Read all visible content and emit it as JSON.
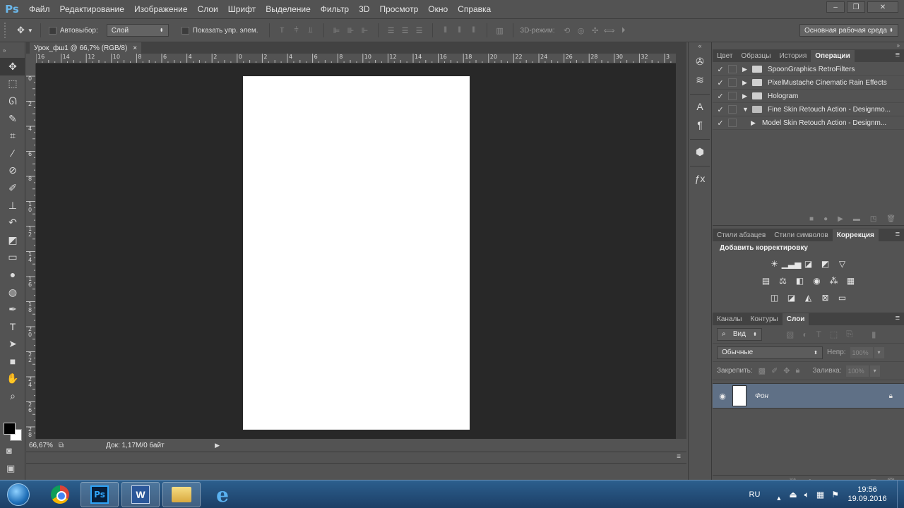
{
  "app": {
    "logo": "Ps"
  },
  "menu": [
    "Файл",
    "Редактирование",
    "Изображение",
    "Слои",
    "Шрифт",
    "Выделение",
    "Фильтр",
    "3D",
    "Просмотр",
    "Окно",
    "Справка"
  ],
  "window_controls": {
    "minimize": "–",
    "restore": "❐",
    "close": "✕"
  },
  "options": {
    "auto_select_label": "Автовыбор:",
    "auto_select_value": "Слой",
    "show_transform_label": "Показать упр. элем.",
    "mode_3d_label": "3D-режим:",
    "workspace": "Основная рабочая среда"
  },
  "document": {
    "tab_title": "Урок_фш1 @ 66,7% (RGB/8)",
    "tab_close": "×",
    "zoom": "66,67%",
    "doc_info": "Док: 1,17M/0 байт",
    "ruler_h": [
      "16",
      "14",
      "12",
      "10",
      "8",
      "6",
      "4",
      "2",
      "0",
      "2",
      "4",
      "6",
      "8",
      "10",
      "12",
      "14",
      "16",
      "18",
      "20",
      "22",
      "24",
      "26",
      "28",
      "30",
      "32",
      "3"
    ],
    "ruler_v": [
      "0",
      "2",
      "4",
      "6",
      "8",
      "1 0",
      "1 2",
      "1 4",
      "1 6",
      "1 8",
      "2 0",
      "2 2",
      "2 4",
      "2 6",
      "2 8"
    ]
  },
  "panels": {
    "actions": {
      "tabs": [
        "Цвет",
        "Образцы",
        "История",
        "Операции"
      ],
      "active_tab": "Операции",
      "items": [
        {
          "check": "✓",
          "expand": "▶",
          "name": "SpoonGraphics RetroFilters",
          "folder": true
        },
        {
          "check": "✓",
          "expand": "▶",
          "name": "PixelMustache Cinematic Rain Effects",
          "folder": true
        },
        {
          "check": "✓",
          "expand": "▶",
          "name": "Hologram",
          "folder": true
        },
        {
          "check": "✓",
          "expand": "▼",
          "name": "Fine Skin Retouch Action - Designmo...",
          "folder": true
        },
        {
          "check": "✓",
          "expand": "▶",
          "name": "Model Skin Retouch Action - Designm...",
          "folder": false
        }
      ]
    },
    "adjustments": {
      "tabs": [
        "Стили абзацев",
        "Стили символов",
        "Коррекция"
      ],
      "active_tab": "Коррекция",
      "title": "Добавить корректировку"
    },
    "layers": {
      "tabs": [
        "Каналы",
        "Контуры",
        "Слои"
      ],
      "active_tab": "Слои",
      "filter_label": "Вид",
      "blend_mode": "Обычные",
      "opacity_label": "Непр:",
      "opacity_value": "100%",
      "lock_label": "Закрепить:",
      "fill_label": "Заливка:",
      "fill_value": "100%",
      "layer_name": "Фон"
    }
  },
  "taskbar": {
    "language": "RU",
    "time": "19:56",
    "date": "19.09.2016"
  }
}
